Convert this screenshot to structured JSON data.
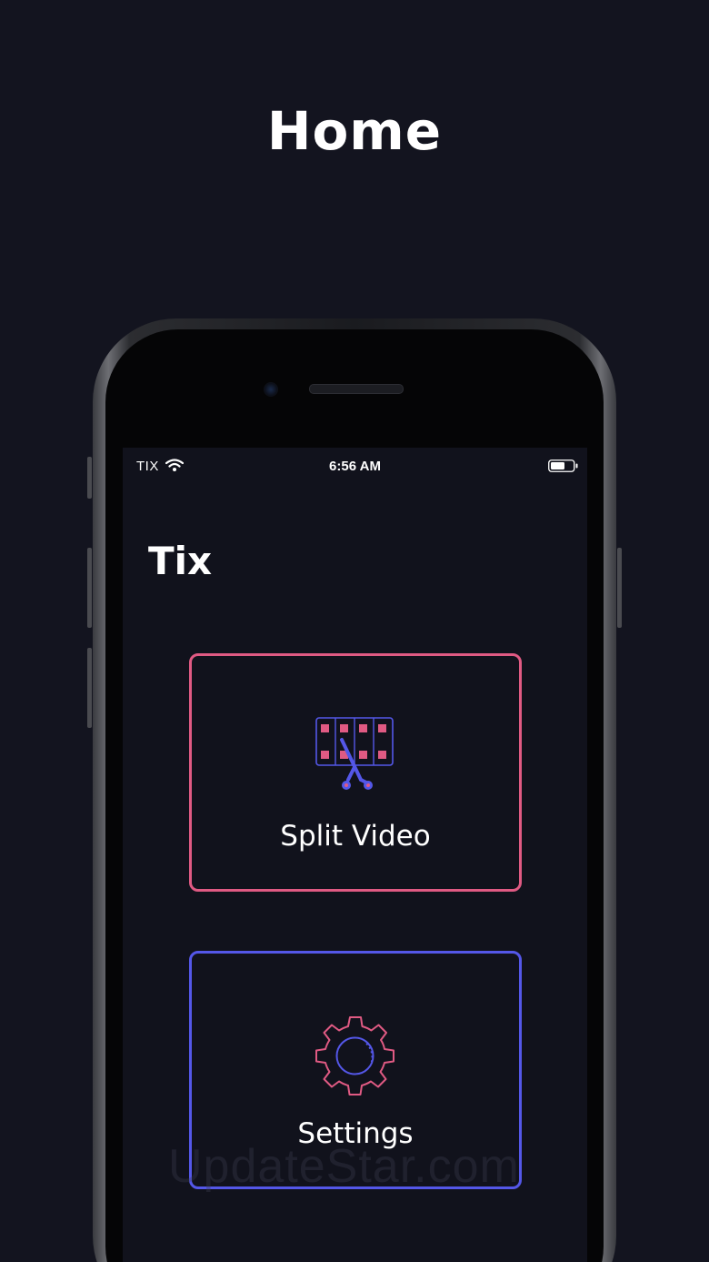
{
  "headline": "Home",
  "status_bar": {
    "carrier": "TIX",
    "time": "6:56 AM",
    "wifi_icon": "wifi-icon",
    "battery_icon": "battery-icon"
  },
  "app": {
    "title": "Tix"
  },
  "cards": {
    "split_video": {
      "label": "Split Video",
      "icon": "film-scissors-icon",
      "border_color": "#e05a83"
    },
    "settings": {
      "label": "Settings",
      "icon": "gear-icon",
      "border_color": "#5457e8"
    }
  },
  "colors": {
    "background": "#13141f",
    "screen": "#11121c",
    "accent_pink": "#e05a83",
    "accent_blue": "#5457e8"
  },
  "watermark": "UpdateStar.com"
}
